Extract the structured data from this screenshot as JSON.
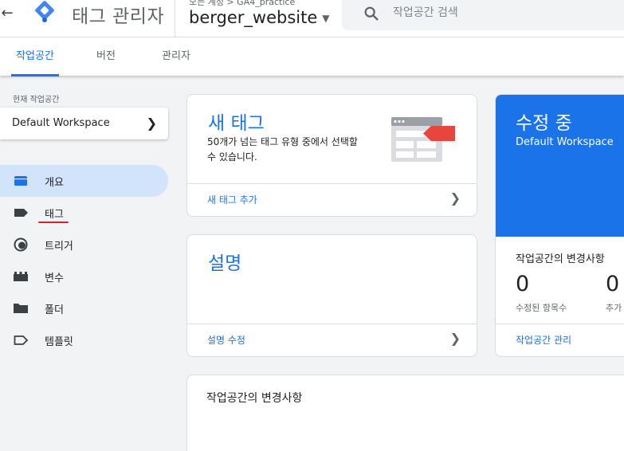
{
  "header": {
    "app_title": "태그 관리자",
    "breadcrumb": "모든 계정 > GA4_practice",
    "container_name": "berger_website",
    "search_placeholder": "작업공간 검색"
  },
  "tabs": [
    {
      "label": "작업공간",
      "active": true
    },
    {
      "label": "버전",
      "active": false
    },
    {
      "label": "관리자",
      "active": false
    }
  ],
  "sidebar": {
    "workspace_label": "현재 작업공간",
    "workspace_name": "Default Workspace",
    "items": [
      {
        "label": "개요",
        "icon": "overview-icon",
        "active": true
      },
      {
        "label": "태그",
        "icon": "tag-icon",
        "active": false
      },
      {
        "label": "트리거",
        "icon": "trigger-icon",
        "active": false
      },
      {
        "label": "변수",
        "icon": "variable-icon",
        "active": false
      },
      {
        "label": "폴더",
        "icon": "folder-icon",
        "active": false
      },
      {
        "label": "템플릿",
        "icon": "template-icon",
        "active": false
      }
    ]
  },
  "new_tag_card": {
    "title": "새 태그",
    "description": "50개가 넘는 태그 유형 중에서 선택할 수 있습니다.",
    "link": "새 태그 추가"
  },
  "description_card": {
    "title": "설명",
    "link": "설명 수정"
  },
  "editing_card": {
    "title": "수정 중",
    "workspace": "Default Workspace",
    "changes_heading": "작업공간의 변경사항",
    "modified_count": "0",
    "modified_label": "수정된 항목수",
    "added_count": "0",
    "added_label": "추가",
    "manage_link": "작업공간 관리"
  },
  "changes_card": {
    "title": "작업공간의 변경사항"
  },
  "colors": {
    "accent": "#1a73e8",
    "active_nav_bg": "#d2e3fc",
    "tag_red": "#e8453c"
  }
}
